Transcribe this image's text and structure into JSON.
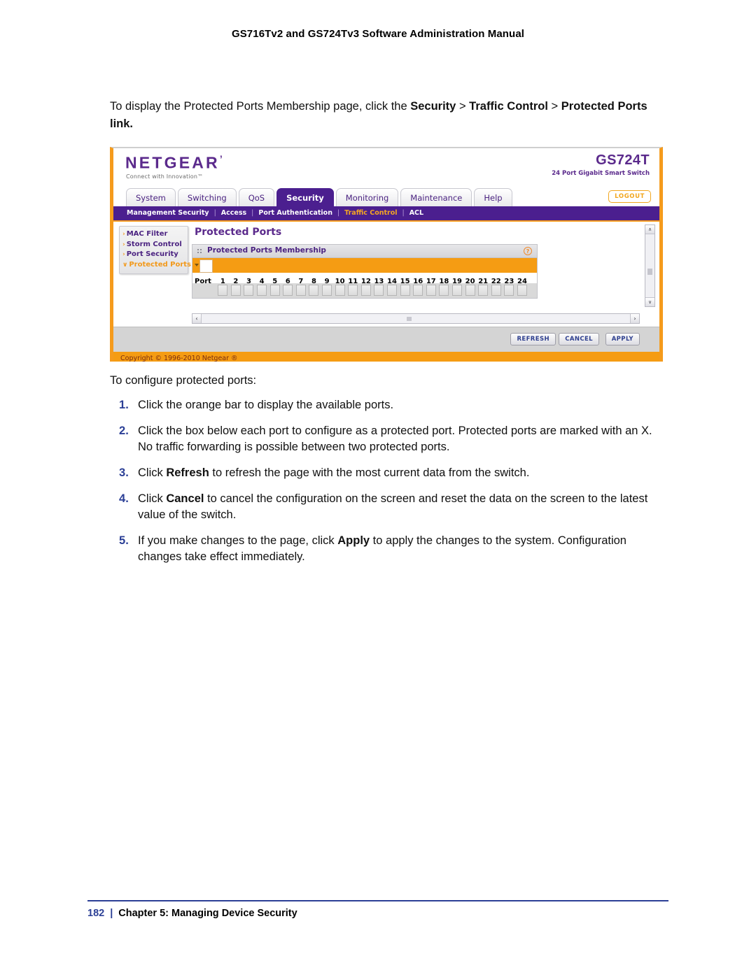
{
  "document": {
    "header_title": "GS716Tv2 and GS724Tv3 Software Administration Manual",
    "footer": {
      "page_number": "182",
      "separator": "|",
      "chapter": "Chapter 5:  Managing Device Security"
    }
  },
  "intro": {
    "part1": "To display the Protected Ports Membership page, click the ",
    "bold1": "Security",
    "gt1": ">",
    "bold2": "Traffic Control",
    "gt2": ">",
    "bold3": "Protected Ports link."
  },
  "screenshot": {
    "brand": {
      "logo": "NETGEAR",
      "logo_tm": "’",
      "tagline": "Connect with Innovation™",
      "model": "GS724T",
      "model_desc": "24 Port Gigabit Smart Switch"
    },
    "tabs": [
      {
        "label": "System",
        "active": false
      },
      {
        "label": "Switching",
        "active": false
      },
      {
        "label": "QoS",
        "active": false
      },
      {
        "label": "Security",
        "active": true
      },
      {
        "label": "Monitoring",
        "active": false
      },
      {
        "label": "Maintenance",
        "active": false
      },
      {
        "label": "Help",
        "active": false
      }
    ],
    "logout_label": "LOGOUT",
    "subnav": [
      {
        "label": "Management Security",
        "active": false
      },
      {
        "label": "Access",
        "active": false
      },
      {
        "label": "Port Authentication",
        "active": false
      },
      {
        "label": "Traffic Control",
        "active": true
      },
      {
        "label": "ACL",
        "active": false
      }
    ],
    "subnav_separator": "|",
    "sidebar": [
      {
        "label": "MAC Filter",
        "arrow": "›",
        "active": false
      },
      {
        "label": "Storm Control",
        "arrow": "›",
        "active": false
      },
      {
        "label": "Port Security",
        "arrow": "›",
        "active": false
      },
      {
        "label": "Protected Ports",
        "arrow": "∨",
        "active": true
      }
    ],
    "page_title": "Protected Ports",
    "panel": {
      "title": "Protected Ports Membership",
      "help_glyph": "?",
      "port_label": "Port",
      "port_numbers": [
        "1",
        "2",
        "3",
        "4",
        "5",
        "6",
        "7",
        "8",
        "9",
        "10",
        "11",
        "12",
        "13",
        "14",
        "15",
        "16",
        "17",
        "18",
        "19",
        "20",
        "21",
        "22",
        "23",
        "24"
      ]
    },
    "scroll": {
      "up_arrow": "∧",
      "down_arrow": "∨",
      "left_arrow": "‹",
      "right_arrow": "›"
    },
    "buttons": [
      {
        "label": "REFRESH"
      },
      {
        "label": "CANCEL"
      },
      {
        "label": "APPLY"
      }
    ],
    "copyright": "Copyright © 1996-2010 Netgear ®",
    "colors": {
      "purple": "#4b1f8f",
      "orange": "#f59c13",
      "accent_text": "#5b2a8c"
    }
  },
  "instructions": {
    "lead": "To configure protected ports:",
    "steps": [
      {
        "segments": [
          {
            "text": "Click the orange bar to display the available ports.",
            "bold": false
          }
        ]
      },
      {
        "segments": [
          {
            "text": "Click the box below each port to configure as a protected port. Protected ports are marked with an X. No traffic forwarding is possible between two protected ports.",
            "bold": false
          }
        ]
      },
      {
        "segments": [
          {
            "text": "Click ",
            "bold": false
          },
          {
            "text": "Refresh",
            "bold": true
          },
          {
            "text": " to refresh the page with the most current data from the switch.",
            "bold": false
          }
        ]
      },
      {
        "segments": [
          {
            "text": "Click ",
            "bold": false
          },
          {
            "text": "Cancel",
            "bold": true
          },
          {
            "text": " to cancel the configuration on the screen and reset the data on the screen to the latest value of the switch.",
            "bold": false
          }
        ]
      },
      {
        "segments": [
          {
            "text": "If you make changes to the page, click ",
            "bold": false
          },
          {
            "text": "Apply",
            "bold": true
          },
          {
            "text": " to apply the changes to the system. Configuration changes take effect immediately.",
            "bold": false
          }
        ]
      }
    ]
  }
}
